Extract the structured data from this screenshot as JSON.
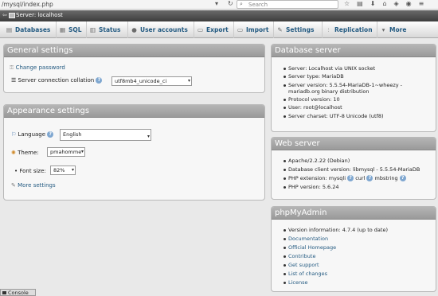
{
  "browser": {
    "url": "/mysql/index.php",
    "search_placeholder": "Search"
  },
  "breadcrumb": {
    "server": "Server: localhost"
  },
  "tabs": [
    {
      "label": "Databases"
    },
    {
      "label": "SQL"
    },
    {
      "label": "Status"
    },
    {
      "label": "User accounts"
    },
    {
      "label": "Export"
    },
    {
      "label": "Import"
    },
    {
      "label": "Settings"
    },
    {
      "label": "Replication"
    },
    {
      "label": "More"
    }
  ],
  "general_settings": {
    "title": "General settings",
    "change_password": "Change password",
    "collation_label": "Server connection collation",
    "collation_value": "utf8mb4_unicode_ci"
  },
  "appearance_settings": {
    "title": "Appearance settings",
    "language_label": "Language",
    "language_value": "English",
    "theme_label": "Theme:",
    "theme_value": "pmahomme",
    "font_size_label": "Font size:",
    "font_size_value": "82%",
    "more_settings": "More settings"
  },
  "database_server": {
    "title": "Database server",
    "items": [
      "Server: Localhost via UNIX socket",
      "Server type: MariaDB",
      "Server version: 5.5.54-MariaDB-1~wheezy -",
      "mariadb.org binary distribution",
      "Protocol version: 10",
      "User: root@localhost",
      "Server charset: UTF-8 Unicode (utf8)"
    ]
  },
  "web_server": {
    "title": "Web server",
    "items": [
      "Apache/2.2.22 (Debian)",
      "Database client version: libmysql - 5.5.54-MariaDB",
      "PHP extension: mysqli",
      "PHP version: 5.6.24"
    ],
    "ext_curl": "curl",
    "ext_mbstring": "mbstring"
  },
  "phpmyadmin": {
    "title": "phpMyAdmin",
    "version": "Version information: 4.7.4 (up to date)",
    "links": [
      "Documentation",
      "Official Homepage",
      "Contribute",
      "Get support",
      "List of changes",
      "License"
    ]
  },
  "console": {
    "label": "Console"
  }
}
